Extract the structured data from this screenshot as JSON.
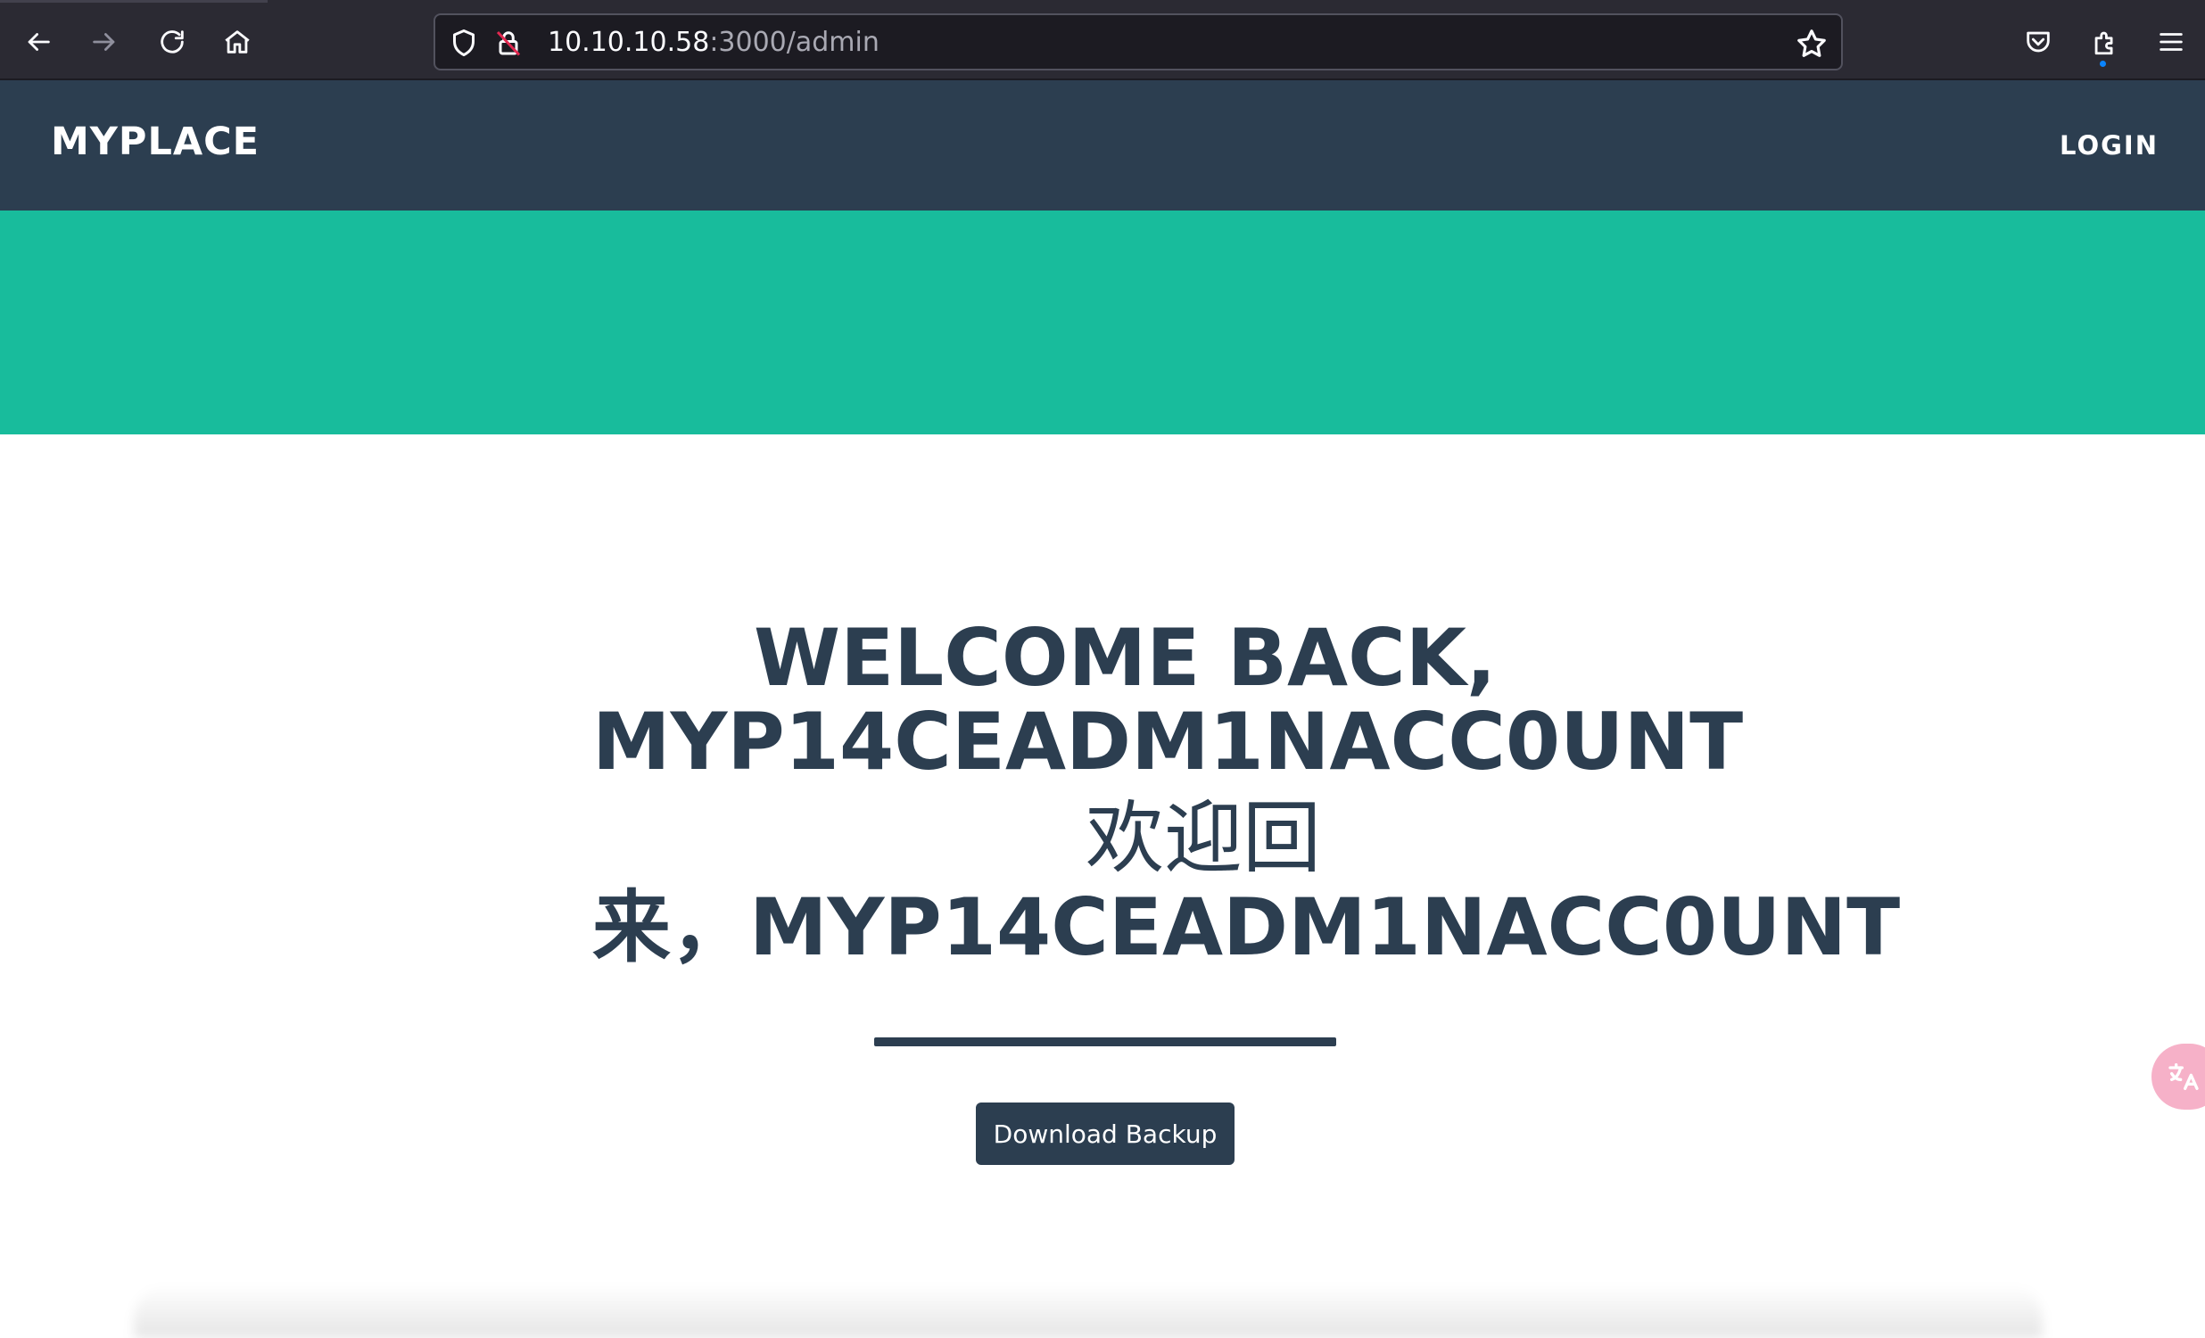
{
  "browser": {
    "url_host": "10.10.10.58",
    "url_path": ":3000/admin"
  },
  "site": {
    "brand": "MYPLACE",
    "login": "LOGIN"
  },
  "main": {
    "welcome_en_line1": "WELCOME BACK,",
    "welcome_en_line2": "MYP14CEADM1NACC0UNT",
    "welcome_zh_line1": "欢迎回",
    "welcome_zh_line2": "来，MYP14CEADM1NACC0UNT",
    "download_button": "Download Backup"
  },
  "colors": {
    "navbar": "#2c3e50",
    "hero": "#18bc9c",
    "browser_chrome": "#2b2a33"
  },
  "icons": [
    "back-icon",
    "forward-icon",
    "reload-icon",
    "home-icon",
    "shield-icon",
    "insecure-lock-icon",
    "bookmark-star-icon",
    "pocket-icon",
    "extensions-icon",
    "menu-icon",
    "translate-icon"
  ]
}
